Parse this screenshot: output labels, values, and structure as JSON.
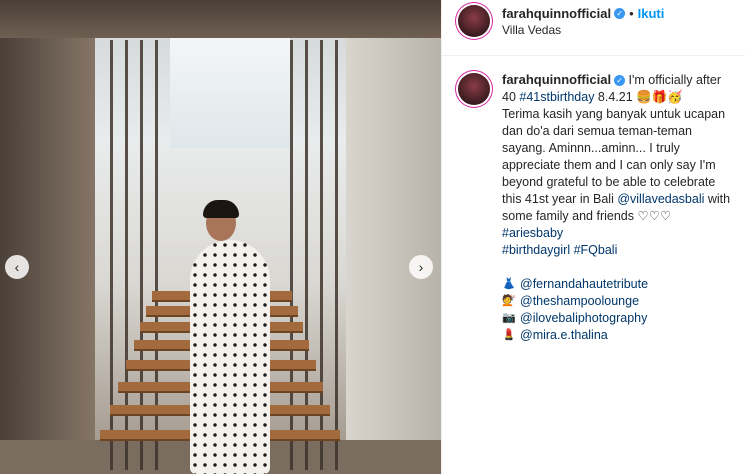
{
  "post": {
    "username": "farahquinnofficial",
    "follow_label": "Ikuti",
    "location": "Villa Vedas",
    "nav": {
      "prev": "‹",
      "next": "›"
    }
  },
  "caption": {
    "username": "farahquinnofficial",
    "text_1": " I'm officially after 40 ",
    "hashtag_41": "#41stbirthday",
    "text_2": " 8.4.21 ",
    "emojis_1": "🍔🎁🥳",
    "text_3": "Terima kasih yang banyak untuk ucapan dan do'a dari semua teman-teman sayang. Aminnn...aminn... I truly appreciate them and I can only say I'm beyond grateful to be able to celebrate this 41st year in Bali ",
    "mention_villa": "@villavedasbali",
    "text_4": " with some family and friends ",
    "hearts": "♡♡♡",
    "hashtag_aries": "#ariesbaby",
    "hashtag_bday": "#birthdaygirl",
    "hashtag_fq": "#FQbali"
  },
  "credits": [
    {
      "icon": "👗",
      "icon_name": "dress-icon",
      "handle": "@fernandahautetribute"
    },
    {
      "icon": "💇",
      "icon_name": "haircut-icon",
      "handle": "@theshampoolounge"
    },
    {
      "icon": "📷",
      "icon_name": "camera-icon",
      "handle": "@ilovebaliphotography"
    },
    {
      "icon": "💄",
      "icon_name": "lipstick-icon",
      "handle": "@mira.e.thalina"
    }
  ]
}
